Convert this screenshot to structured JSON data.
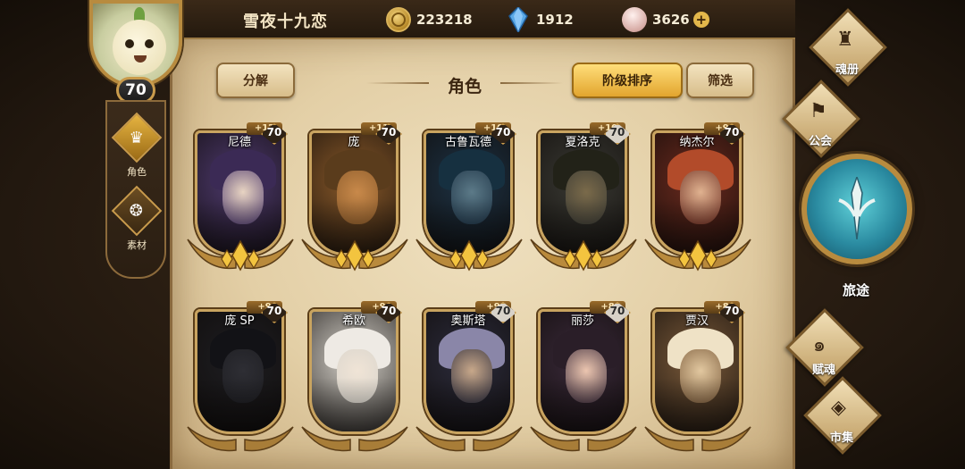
{
  "player": {
    "name": "雪夜十九恋",
    "level": "70"
  },
  "currencies": [
    {
      "icon": "gold-coin-icon",
      "value": "223218"
    },
    {
      "icon": "blue-crystal-icon",
      "value": "1912"
    },
    {
      "icon": "pink-gem-icon",
      "value": "3626"
    }
  ],
  "left_tabs": [
    {
      "label": "角色",
      "icon": "character-icon",
      "active": true
    },
    {
      "label": "素材",
      "icon": "material-icon",
      "active": false
    }
  ],
  "header": {
    "decompose": "分解",
    "title": "角色",
    "sort": "阶级排序",
    "filter": "筛选"
  },
  "cards": [
    {
      "name": "尼德",
      "plus": "+12",
      "level": "70",
      "level_style": "dark",
      "colors": [
        "#4e3a6e",
        "#e8d4c2",
        "#3b2a55"
      ]
    },
    {
      "name": "庞",
      "plus": "+11",
      "level": "70",
      "level_style": "dark",
      "colors": [
        "#8a5a2a",
        "#c8894a",
        "#5a3c1c"
      ]
    },
    {
      "name": "古鲁瓦德",
      "plus": "+10",
      "level": "70",
      "level_style": "dark",
      "colors": [
        "#1d3244",
        "#5c7a88",
        "#163040"
      ]
    },
    {
      "name": "夏洛克",
      "plus": "+10",
      "level": "70",
      "level_style": "grey",
      "colors": [
        "#3a3a34",
        "#7a6a4a",
        "#222218"
      ]
    },
    {
      "name": "纳杰尔",
      "plus": "+9",
      "level": "70",
      "level_style": "dark",
      "colors": [
        "#6a2a1e",
        "#e0b290",
        "#b24b2a"
      ]
    },
    {
      "name": "庞 SP",
      "plus": "+9",
      "level": "70",
      "level_style": "dark",
      "colors": [
        "#1e1e22",
        "#2e2e34",
        "#121216"
      ]
    },
    {
      "name": "希欧",
      "plus": "+9",
      "level": "70",
      "level_style": "dark",
      "colors": [
        "#d8d4cc",
        "#f0e4d6",
        "#eeeae4"
      ]
    },
    {
      "name": "奥斯塔",
      "plus": "+9",
      "level": "70",
      "level_style": "grey",
      "colors": [
        "#2c2c3c",
        "#c8a88a",
        "#8a86a8"
      ]
    },
    {
      "name": "丽莎",
      "plus": "+8",
      "level": "70",
      "level_style": "grey",
      "colors": [
        "#3a2a3a",
        "#ecc6b0",
        "#2a1e28"
      ]
    },
    {
      "name": "贾汉",
      "plus": "+8",
      "level": "70",
      "level_style": "dark",
      "colors": [
        "#7a5a3a",
        "#e2c8a0",
        "#efe2c6"
      ]
    }
  ],
  "right_nav": [
    {
      "label": "魂册",
      "icon": "soul-book-icon"
    },
    {
      "label": "公会",
      "icon": "guild-icon"
    },
    {
      "label": "旅途",
      "icon": "journey-icon"
    },
    {
      "label": "赋魂",
      "icon": "soul-infuse-icon"
    },
    {
      "label": "市集",
      "icon": "market-icon"
    }
  ]
}
